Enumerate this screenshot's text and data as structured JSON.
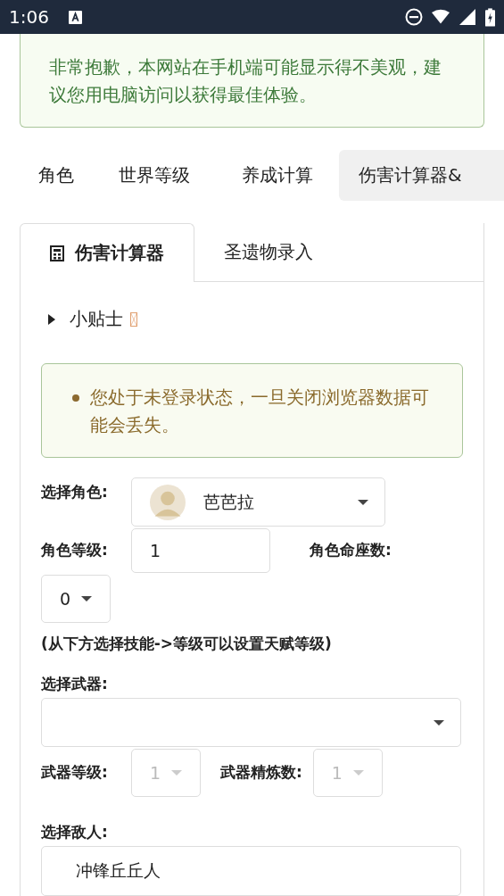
{
  "status_bar": {
    "time": "1:06"
  },
  "notice": {
    "text": "非常抱歉，本网站在手机端可能显示得不美观，建议您用电脑访问以获得最佳体验。"
  },
  "nav_tabs": [
    {
      "label": "角色",
      "selected": false
    },
    {
      "label": "世界等级",
      "selected": false
    },
    {
      "label": "养成计算",
      "selected": false
    },
    {
      "label": "伤害计算器&",
      "selected": true
    }
  ],
  "panel": {
    "tabs": [
      {
        "label": "伤害计算器",
        "selected": true
      },
      {
        "label": "圣遗物录入",
        "selected": false
      }
    ],
    "tips": {
      "label": "小贴士",
      "expanded": false
    },
    "warning": {
      "text": "您处于未登录状态，一旦关闭浏览器数据可能会丢失。"
    },
    "character": {
      "label": "选择角色:",
      "value": "芭芭拉"
    },
    "level": {
      "label": "角色等级:",
      "value": "1"
    },
    "constellation": {
      "label": "角色命座数:",
      "value": "0"
    },
    "note": "(从下方选择技能->等级可以设置天赋等级)",
    "weapon": {
      "label": "选择武器:"
    },
    "weapon_level": {
      "label": "武器等级:",
      "value": "1",
      "disabled": true
    },
    "refinement": {
      "label": "武器精炼数:",
      "value": "1",
      "disabled": true
    },
    "enemy": {
      "label": "选择敌人:",
      "value": "冲锋丘丘人"
    }
  }
}
